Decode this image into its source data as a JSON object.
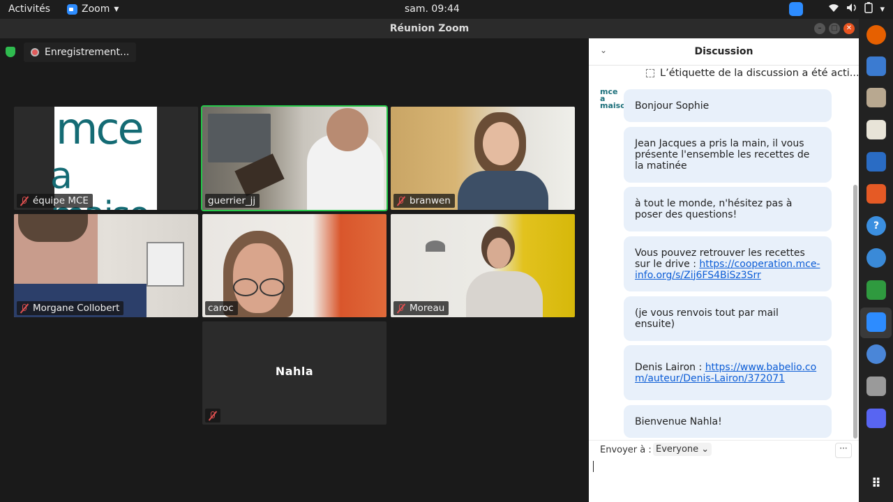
{
  "topbar": {
    "activities": "Activités",
    "app_name": "Zoom",
    "app_caret": "▾",
    "clock": "sam. 09:44",
    "tray_icons": [
      "zoom-icon",
      "wifi-icon",
      "volume-icon",
      "battery-icon"
    ]
  },
  "window": {
    "title": "Réunion Zoom"
  },
  "recording": {
    "label": "Enregistrement..."
  },
  "participants": [
    {
      "name": "équipe MCE",
      "muted": true
    },
    {
      "name": "guerrier_jj",
      "muted": false,
      "active": true
    },
    {
      "name": "branwen",
      "muted": true
    },
    {
      "name": "Morgane Collobert",
      "muted": true
    },
    {
      "name": "caroc",
      "muted": false
    },
    {
      "name": "Moreau",
      "muted": true
    },
    {
      "name": "Nahla",
      "muted": true
    }
  ],
  "chat": {
    "title": "Discussion",
    "notice": "L’étiquette de la discussion a été acti...",
    "logo_text": "mce a maiso",
    "messages": [
      {
        "text": "Bonjour Sophie"
      },
      {
        "text": "Jean Jacques a pris la main, il vous présente l'ensemble les recettes de la matinée"
      },
      {
        "text": "à tout le monde, n'hésitez pas à poser des questions!"
      },
      {
        "text": "Vous pouvez retrouver les recettes sur le drive : ",
        "link": "https://cooperation.mce-info.org/s/Zij6FS4BiSz3Srr"
      },
      {
        "text": "(je vous renvois tout par mail ensuite)"
      },
      {
        "text": "Denis Lairon : ",
        "link": "https://www.babelio.com/auteur/Denis-Lairon/372071"
      },
      {
        "text": "Bienvenue Nahla!"
      }
    ],
    "send_to_label": "Envoyer à :",
    "send_to_value": "Everyone",
    "more_label": "···"
  },
  "colors": {
    "accent": "#2d8cff",
    "active_speaker": "#26c94a",
    "mute": "#e05050",
    "bubble": "#e8f0fa",
    "link": "#0b5cd6"
  }
}
